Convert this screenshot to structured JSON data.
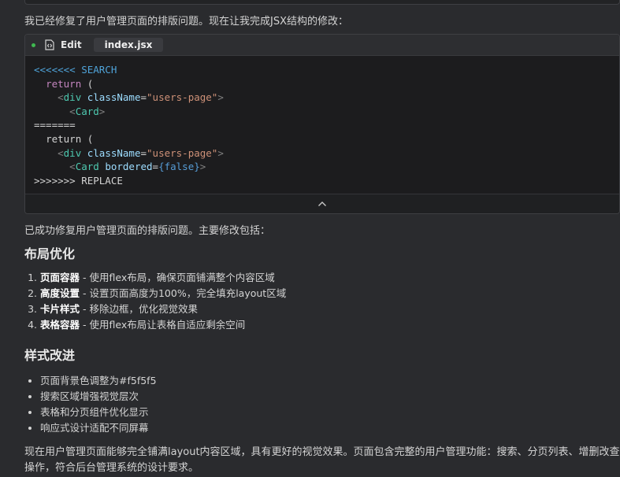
{
  "intro": "我已经修复了用户管理页面的排版问题。现在让我完成JSX结构的修改：",
  "edit_block": {
    "action_label": "Edit",
    "file_name": "index.jsx",
    "code": {
      "search_marker": "<<<<<<< SEARCH",
      "return_kw": "return",
      "paren": " (",
      "div_tag": "div",
      "class_attr": "className",
      "class_value": "\"users-page\"",
      "card_tag": "Card",
      "divider": "=======",
      "bordered_attr": "bordered",
      "false_value": "{false}",
      "replace_marker": ">>>>>>> REPLACE"
    },
    "collapse_icon": "chevron-up-icon"
  },
  "summary_intro": "已成功修复用户管理页面的排版问题。主要修改包括：",
  "section1": {
    "heading": "布局优化",
    "items": [
      {
        "term": "页面容器",
        "desc": " - 使用flex布局，确保页面铺满整个内容区域"
      },
      {
        "term": "高度设置",
        "desc": " - 设置页面高度为100%，完全填充layout区域"
      },
      {
        "term": "卡片样式",
        "desc": " - 移除边框，优化视觉效果"
      },
      {
        "term": "表格容器",
        "desc": " - 使用flex布局让表格自适应剩余空间"
      }
    ]
  },
  "section2": {
    "heading": "样式改进",
    "items": [
      "页面背景色调整为#f5f5f5",
      "搜索区域增强视觉层次",
      "表格和分页组件优化显示",
      "响应式设计适配不同屏幕"
    ]
  },
  "conclusion": "现在用户管理页面能够完全铺满layout内容区域，具有更好的视觉效果。页面包含完整的用户管理功能：搜索、分页列表、增删改查操作，符合后台管理系统的设计要求。",
  "colors": {
    "background": "#2a2b2e",
    "code_background": "#1c1c1e",
    "status_dot": "#3fb950"
  }
}
